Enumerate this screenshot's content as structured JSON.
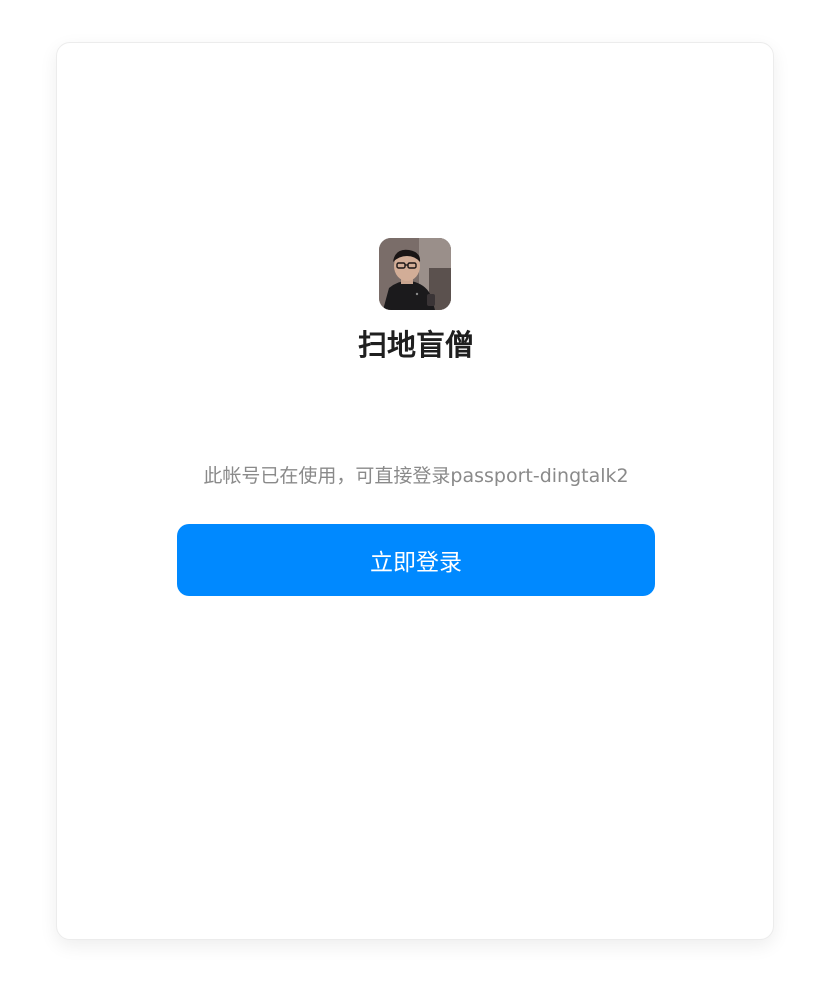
{
  "account": {
    "name": "扫地盲僧",
    "avatar_icon": "user-photo-avatar"
  },
  "message": {
    "text": "此帐号已在使用，可直接登录passport-dingtalk2"
  },
  "actions": {
    "login_label": "立即登录"
  },
  "colors": {
    "accent": "#0089ff",
    "name_text": "#1f1f1f",
    "info_text": "#8a8a8a"
  }
}
